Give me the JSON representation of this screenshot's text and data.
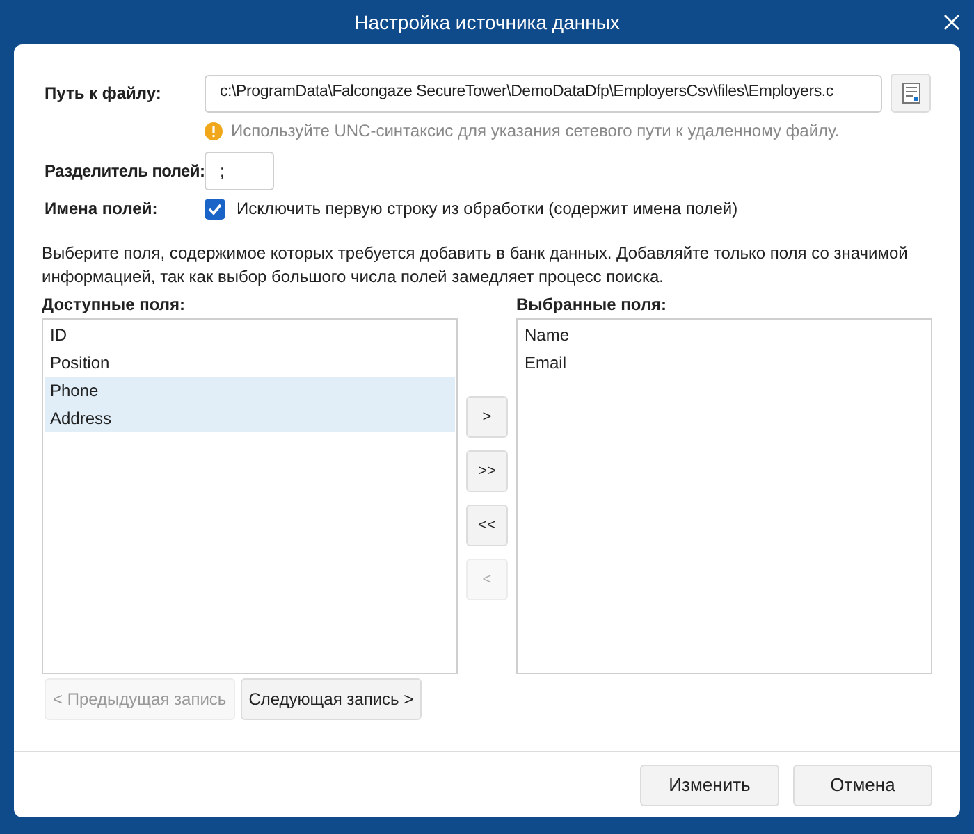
{
  "window": {
    "title": "Настройка источника данных"
  },
  "file_path": {
    "label": "Путь к файлу:",
    "value": "c:\\ProgramData\\Falcongaze SecureTower\\DemoDataDfp\\EmployersCsv\\files\\Employers.c"
  },
  "warning": "Используйте UNC-синтаксис для указания сетевого пути к удаленному файлу.",
  "separator": {
    "label": "Разделитель полей:",
    "value": ";"
  },
  "field_names": {
    "label": "Имена полей:",
    "checkbox": "Исключить первую строку из обработки (содержит имена полей)",
    "checked": true
  },
  "hint": "Выберите поля, содержимое которых требуется добавить в банк данных. Добавляйте только поля со значимой информацией, так как выбор большого числа полей замедляет процесс поиска.",
  "available": {
    "label": "Доступные поля:",
    "items": [
      {
        "text": "ID",
        "selected": false
      },
      {
        "text": "Position",
        "selected": false
      },
      {
        "text": "Phone",
        "selected": true
      },
      {
        "text": "Address",
        "selected": true
      }
    ]
  },
  "move_buttons": [
    {
      "label": ">",
      "disabled": false
    },
    {
      "label": ">>",
      "disabled": false
    },
    {
      "label": "<<",
      "disabled": false
    },
    {
      "label": "<",
      "disabled": true
    }
  ],
  "chosen": {
    "label": "Выбранные поля:",
    "items": [
      {
        "text": "Name",
        "selected": false
      },
      {
        "text": "Email",
        "selected": false
      }
    ]
  },
  "record_buttons": [
    {
      "label": "< Предыдущая запись",
      "disabled": true
    },
    {
      "label": "Следующая запись >",
      "disabled": false
    }
  ],
  "footer_buttons": [
    "Изменить",
    "Отмена"
  ]
}
